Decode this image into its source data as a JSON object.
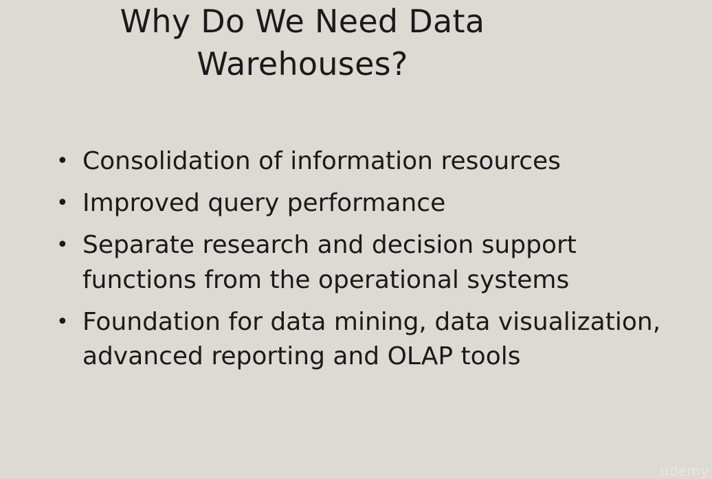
{
  "slide": {
    "title_line1": "Why Do We Need Data",
    "title_line2": "Warehouses?",
    "bullets": [
      "Consolidation of information resources",
      "Improved query performance",
      "Separate research and decision support functions from the operational systems",
      "Foundation for data mining, data visualization, advanced reporting and OLAP tools"
    ],
    "bullet_symbol": "•"
  },
  "watermark": "udemy",
  "colors": {
    "background": "#ddd9d3",
    "text": "#1a1a1a"
  }
}
